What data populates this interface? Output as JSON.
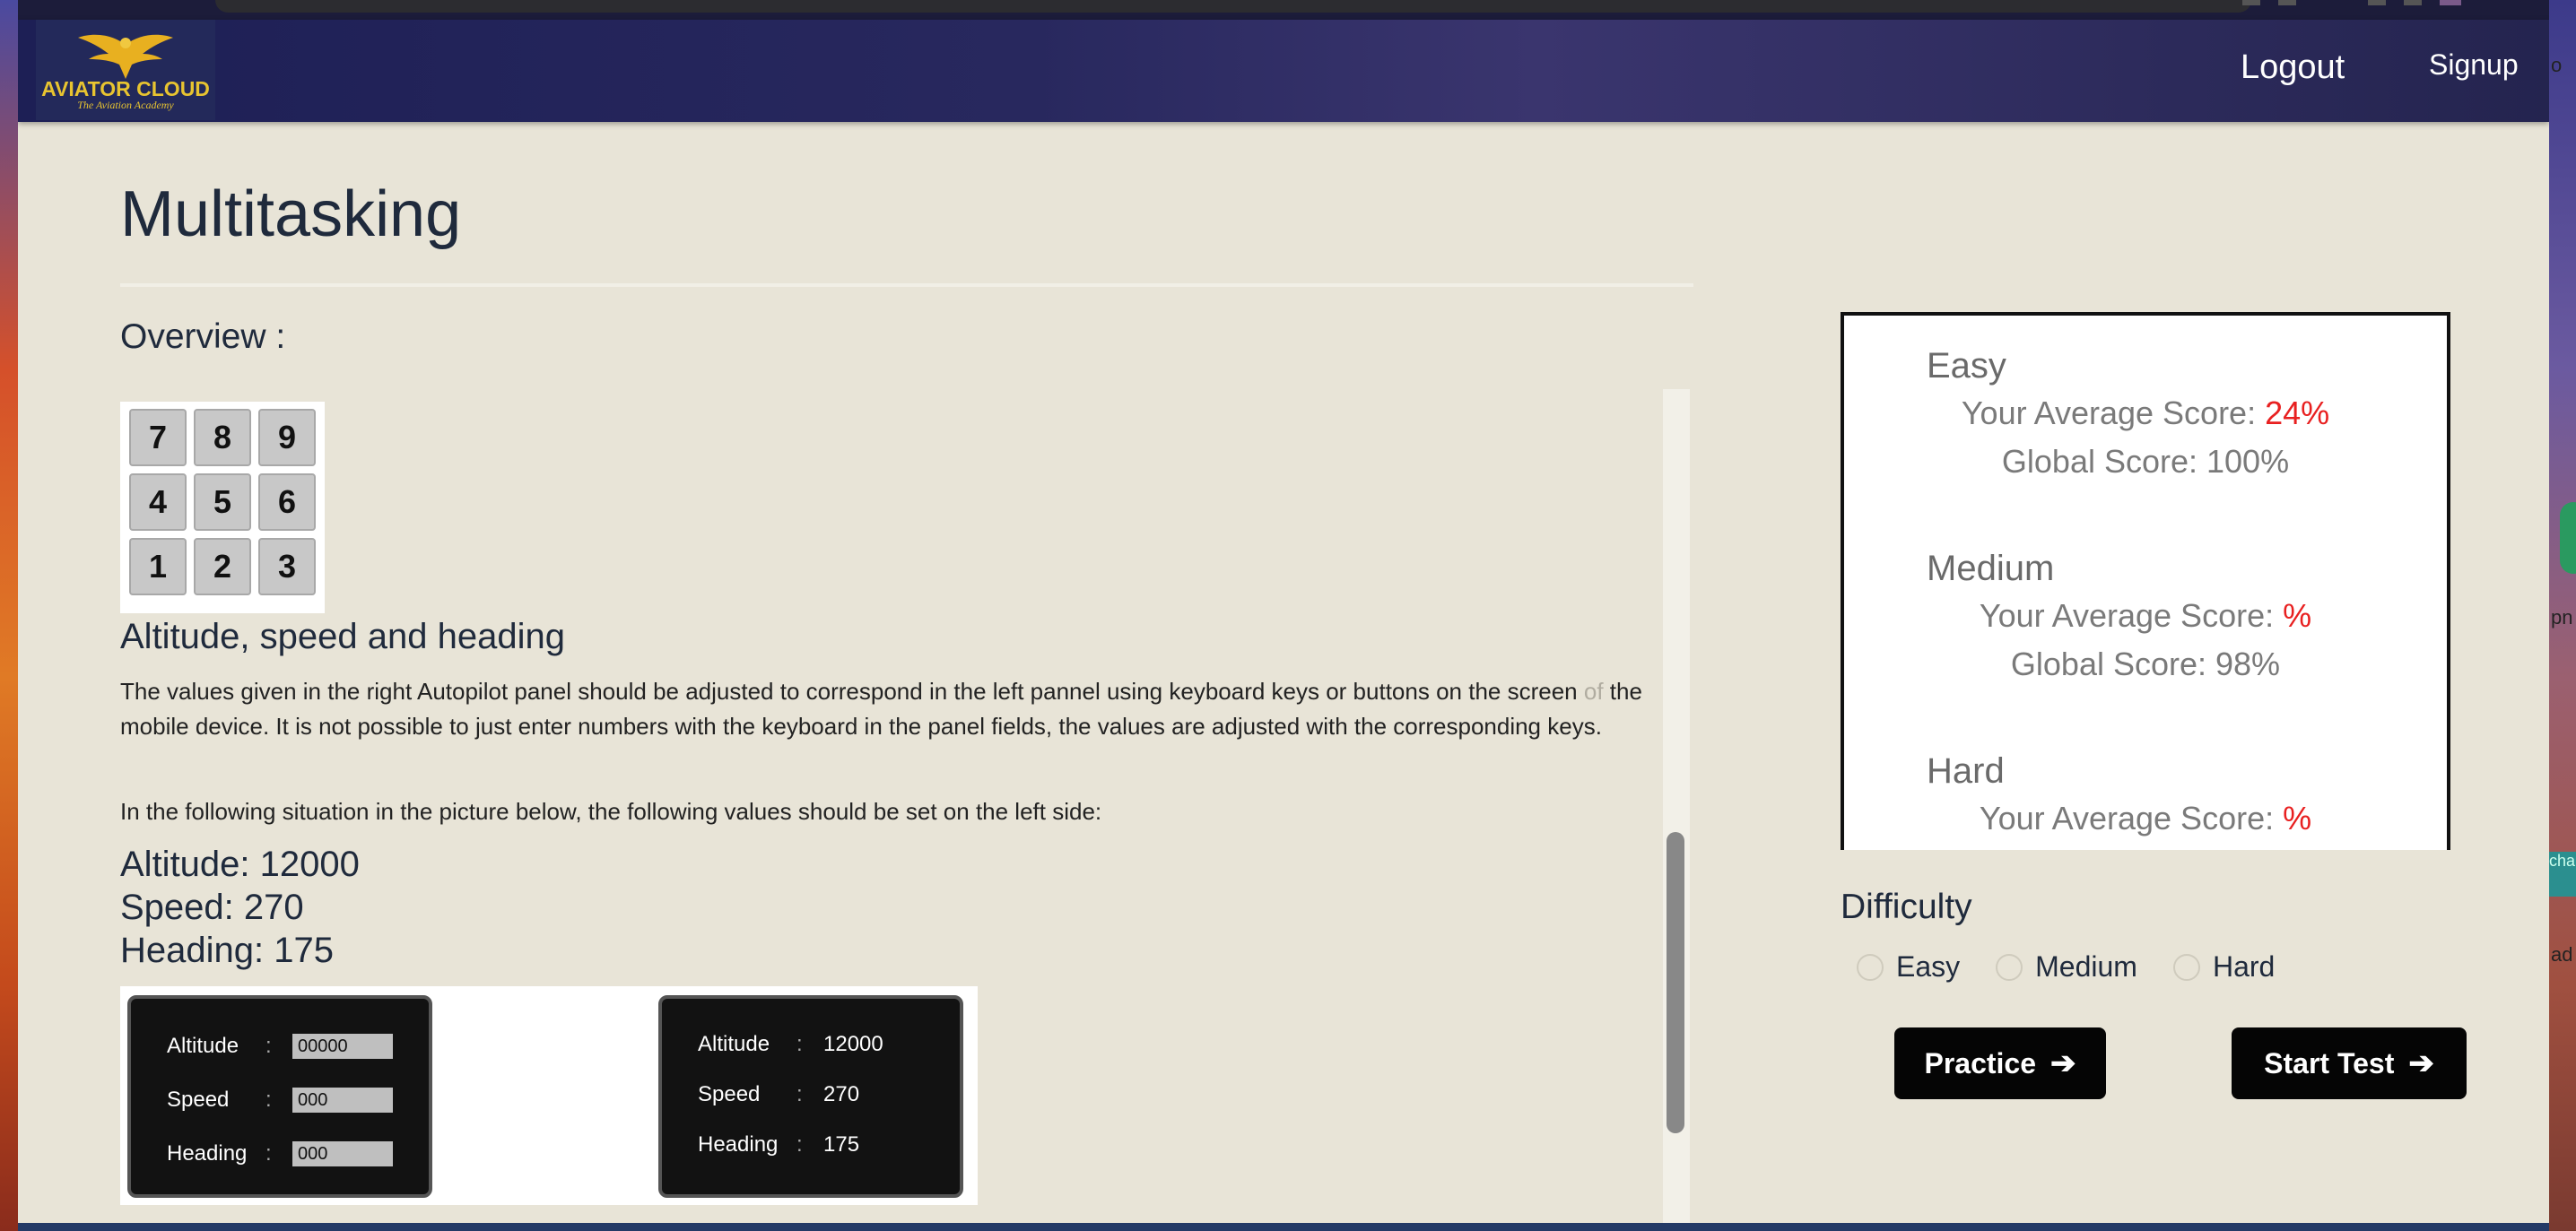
{
  "navbar": {
    "logo_title": "AVIATOR CLOUD",
    "logo_subtitle": "The Aviation Academy",
    "logout_label": "Logout",
    "signup_label": "Signup",
    "extra_label": "o"
  },
  "page": {
    "title": "Multitasking",
    "overview_label": "Overview :"
  },
  "keypad": [
    "7",
    "8",
    "9",
    "4",
    "5",
    "6",
    "1",
    "2",
    "3"
  ],
  "section": {
    "heading": "Altitude, speed and heading",
    "paragraph1": "The values given in the right Autopilot panel should be adjusted to correspond in the left pannel using keyboard keys or buttons on the screen",
    "paragraph1_of": "of",
    "paragraph1_rest": "the mobile device. It is not possible to just enter numbers with the keyboard in the panel fields, the values are adjusted with the corresponding keys.",
    "paragraph2": "In the following situation in the picture below, the following values should be set on the left side:",
    "altitude_line": "Altitude: 12000",
    "speed_line": "Speed: 270",
    "heading_line": "Heading: 175"
  },
  "figure": {
    "labels": [
      "Altitude",
      "Speed",
      "Heading"
    ],
    "colon": ":",
    "left_values": [
      "00000",
      "000",
      "000"
    ],
    "right_values": [
      "12000",
      "270",
      "175"
    ]
  },
  "scores": [
    {
      "level": "Easy",
      "avg_label": "Your Average Score: ",
      "avg_value": "24%",
      "global": "Global Score: 100%"
    },
    {
      "level": "Medium",
      "avg_label": "Your Average Score: ",
      "avg_value": "%",
      "global": "Global Score: 98%"
    },
    {
      "level": "Hard",
      "avg_label": "Your Average Score: ",
      "avg_value": "%",
      "global": ""
    }
  ],
  "difficulty": {
    "title": "Difficulty",
    "options": [
      "Easy",
      "Medium",
      "Hard"
    ]
  },
  "actions": {
    "practice_label": "Practice",
    "start_label": "Start Test",
    "arrow": "➔"
  },
  "desktop_right": {
    "frag1": "o",
    "frag2": "pn",
    "frag3": "cha",
    "frag4": "ad"
  }
}
